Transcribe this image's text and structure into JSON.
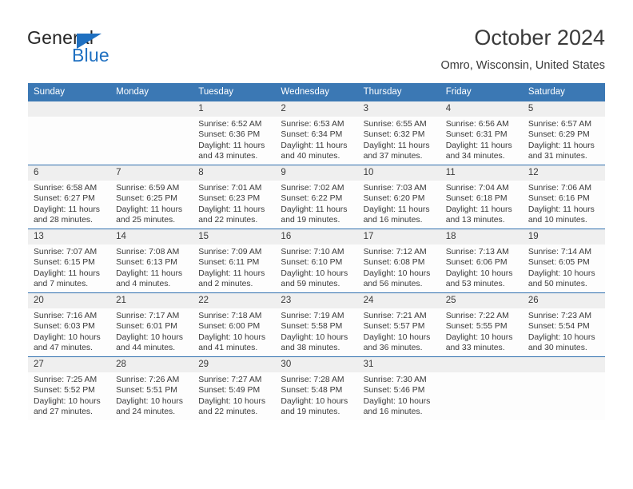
{
  "brand": {
    "name_part1": "General",
    "name_part2": "Blue",
    "triangle_icon": "triangle-icon",
    "color_dark": "#262626",
    "color_blue": "#1f70c1"
  },
  "header": {
    "title": "October 2024",
    "location": "Omro, Wisconsin, United States"
  },
  "theme": {
    "header_blue": "#3b78b4",
    "row_divider_blue": "#2f6fae",
    "day_strip_gray": "#efefef",
    "text": "#3a3a3a"
  },
  "weekday_headers": [
    "Sunday",
    "Monday",
    "Tuesday",
    "Wednesday",
    "Thursday",
    "Friday",
    "Saturday"
  ],
  "labels": {
    "sunrise_prefix": "Sunrise:",
    "sunset_prefix": "Sunset:",
    "daylight_prefix": "Daylight:"
  },
  "weeks": [
    [
      {
        "day": "",
        "sunrise": "",
        "sunset": "",
        "daylight": "",
        "empty": true
      },
      {
        "day": "",
        "sunrise": "",
        "sunset": "",
        "daylight": "",
        "empty": true
      },
      {
        "day": "1",
        "sunrise": "Sunrise: 6:52 AM",
        "sunset": "Sunset: 6:36 PM",
        "daylight": "Daylight: 11 hours and 43 minutes."
      },
      {
        "day": "2",
        "sunrise": "Sunrise: 6:53 AM",
        "sunset": "Sunset: 6:34 PM",
        "daylight": "Daylight: 11 hours and 40 minutes."
      },
      {
        "day": "3",
        "sunrise": "Sunrise: 6:55 AM",
        "sunset": "Sunset: 6:32 PM",
        "daylight": "Daylight: 11 hours and 37 minutes."
      },
      {
        "day": "4",
        "sunrise": "Sunrise: 6:56 AM",
        "sunset": "Sunset: 6:31 PM",
        "daylight": "Daylight: 11 hours and 34 minutes."
      },
      {
        "day": "5",
        "sunrise": "Sunrise: 6:57 AM",
        "sunset": "Sunset: 6:29 PM",
        "daylight": "Daylight: 11 hours and 31 minutes."
      }
    ],
    [
      {
        "day": "6",
        "sunrise": "Sunrise: 6:58 AM",
        "sunset": "Sunset: 6:27 PM",
        "daylight": "Daylight: 11 hours and 28 minutes."
      },
      {
        "day": "7",
        "sunrise": "Sunrise: 6:59 AM",
        "sunset": "Sunset: 6:25 PM",
        "daylight": "Daylight: 11 hours and 25 minutes."
      },
      {
        "day": "8",
        "sunrise": "Sunrise: 7:01 AM",
        "sunset": "Sunset: 6:23 PM",
        "daylight": "Daylight: 11 hours and 22 minutes."
      },
      {
        "day": "9",
        "sunrise": "Sunrise: 7:02 AM",
        "sunset": "Sunset: 6:22 PM",
        "daylight": "Daylight: 11 hours and 19 minutes."
      },
      {
        "day": "10",
        "sunrise": "Sunrise: 7:03 AM",
        "sunset": "Sunset: 6:20 PM",
        "daylight": "Daylight: 11 hours and 16 minutes."
      },
      {
        "day": "11",
        "sunrise": "Sunrise: 7:04 AM",
        "sunset": "Sunset: 6:18 PM",
        "daylight": "Daylight: 11 hours and 13 minutes."
      },
      {
        "day": "12",
        "sunrise": "Sunrise: 7:06 AM",
        "sunset": "Sunset: 6:16 PM",
        "daylight": "Daylight: 11 hours and 10 minutes."
      }
    ],
    [
      {
        "day": "13",
        "sunrise": "Sunrise: 7:07 AM",
        "sunset": "Sunset: 6:15 PM",
        "daylight": "Daylight: 11 hours and 7 minutes."
      },
      {
        "day": "14",
        "sunrise": "Sunrise: 7:08 AM",
        "sunset": "Sunset: 6:13 PM",
        "daylight": "Daylight: 11 hours and 4 minutes."
      },
      {
        "day": "15",
        "sunrise": "Sunrise: 7:09 AM",
        "sunset": "Sunset: 6:11 PM",
        "daylight": "Daylight: 11 hours and 2 minutes."
      },
      {
        "day": "16",
        "sunrise": "Sunrise: 7:10 AM",
        "sunset": "Sunset: 6:10 PM",
        "daylight": "Daylight: 10 hours and 59 minutes."
      },
      {
        "day": "17",
        "sunrise": "Sunrise: 7:12 AM",
        "sunset": "Sunset: 6:08 PM",
        "daylight": "Daylight: 10 hours and 56 minutes."
      },
      {
        "day": "18",
        "sunrise": "Sunrise: 7:13 AM",
        "sunset": "Sunset: 6:06 PM",
        "daylight": "Daylight: 10 hours and 53 minutes."
      },
      {
        "day": "19",
        "sunrise": "Sunrise: 7:14 AM",
        "sunset": "Sunset: 6:05 PM",
        "daylight": "Daylight: 10 hours and 50 minutes."
      }
    ],
    [
      {
        "day": "20",
        "sunrise": "Sunrise: 7:16 AM",
        "sunset": "Sunset: 6:03 PM",
        "daylight": "Daylight: 10 hours and 47 minutes."
      },
      {
        "day": "21",
        "sunrise": "Sunrise: 7:17 AM",
        "sunset": "Sunset: 6:01 PM",
        "daylight": "Daylight: 10 hours and 44 minutes."
      },
      {
        "day": "22",
        "sunrise": "Sunrise: 7:18 AM",
        "sunset": "Sunset: 6:00 PM",
        "daylight": "Daylight: 10 hours and 41 minutes."
      },
      {
        "day": "23",
        "sunrise": "Sunrise: 7:19 AM",
        "sunset": "Sunset: 5:58 PM",
        "daylight": "Daylight: 10 hours and 38 minutes."
      },
      {
        "day": "24",
        "sunrise": "Sunrise: 7:21 AM",
        "sunset": "Sunset: 5:57 PM",
        "daylight": "Daylight: 10 hours and 36 minutes."
      },
      {
        "day": "25",
        "sunrise": "Sunrise: 7:22 AM",
        "sunset": "Sunset: 5:55 PM",
        "daylight": "Daylight: 10 hours and 33 minutes."
      },
      {
        "day": "26",
        "sunrise": "Sunrise: 7:23 AM",
        "sunset": "Sunset: 5:54 PM",
        "daylight": "Daylight: 10 hours and 30 minutes."
      }
    ],
    [
      {
        "day": "27",
        "sunrise": "Sunrise: 7:25 AM",
        "sunset": "Sunset: 5:52 PM",
        "daylight": "Daylight: 10 hours and 27 minutes."
      },
      {
        "day": "28",
        "sunrise": "Sunrise: 7:26 AM",
        "sunset": "Sunset: 5:51 PM",
        "daylight": "Daylight: 10 hours and 24 minutes."
      },
      {
        "day": "29",
        "sunrise": "Sunrise: 7:27 AM",
        "sunset": "Sunset: 5:49 PM",
        "daylight": "Daylight: 10 hours and 22 minutes."
      },
      {
        "day": "30",
        "sunrise": "Sunrise: 7:28 AM",
        "sunset": "Sunset: 5:48 PM",
        "daylight": "Daylight: 10 hours and 19 minutes."
      },
      {
        "day": "31",
        "sunrise": "Sunrise: 7:30 AM",
        "sunset": "Sunset: 5:46 PM",
        "daylight": "Daylight: 10 hours and 16 minutes."
      },
      {
        "day": "",
        "sunrise": "",
        "sunset": "",
        "daylight": "",
        "empty": true
      },
      {
        "day": "",
        "sunrise": "",
        "sunset": "",
        "daylight": "",
        "empty": true
      }
    ]
  ]
}
